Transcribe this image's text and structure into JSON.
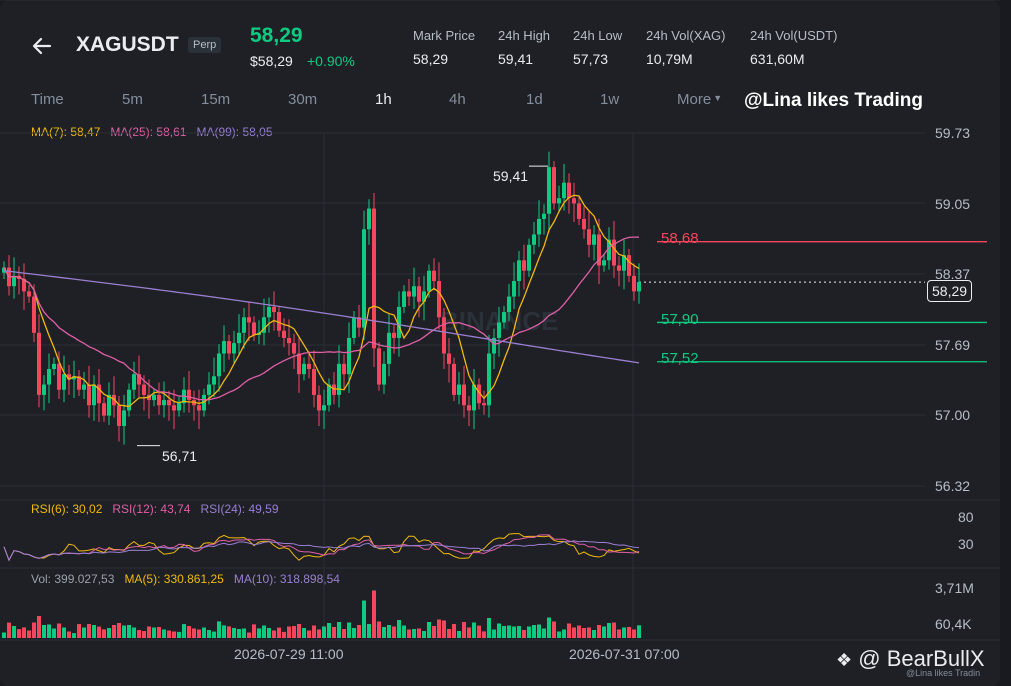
{
  "header": {
    "symbol": "XAGUSDT",
    "badge": "Perp",
    "last_price": "58,29",
    "last_price_usd": "$58,29",
    "change": "+0.90%",
    "stats": [
      {
        "label": "Mark Price",
        "value": "58,29"
      },
      {
        "label": "24h High",
        "value": "59,41"
      },
      {
        "label": "24h Low",
        "value": "57,73"
      },
      {
        "label": "24h Vol(XAG)",
        "value": "10,79M"
      },
      {
        "label": "24h Vol(USDT)",
        "value": "631,60M"
      }
    ]
  },
  "timeframes": [
    "Time",
    "5m",
    "15m",
    "30m",
    "1h",
    "4h",
    "1d",
    "1w",
    "More"
  ],
  "active_timeframe": "1h",
  "watermark_text": "@Lina likes Trading",
  "ma_legend": {
    "ma7": "MA(7): 58,47",
    "ma25": "MA(25): 58,61",
    "ma99": "MA(99): 58,05"
  },
  "rsi_legend": {
    "rsi6": "RSI(6): 30,02",
    "rsi12": "RSI(12): 43,74",
    "rsi24": "RSI(24): 49,59"
  },
  "vol_legend": {
    "vol": "Vol: 399.027,53",
    "ma5": "MA(5): 330.861,25",
    "ma10": "MA(10): 318.898,54"
  },
  "price_axis": [
    "59.73",
    "59.05",
    "58.37",
    "57.69",
    "57.00",
    "56.32"
  ],
  "rsi_axis": [
    "80",
    "30"
  ],
  "vol_axis": [
    "3,71M",
    "60,4K"
  ],
  "time_axis": [
    "2026-07-29 11:00",
    "2026-07-31 07:00"
  ],
  "levels": [
    {
      "label": "58,68",
      "value": 58.68,
      "color": "#f6465d"
    },
    {
      "label": "57,90",
      "value": 57.9,
      "color": "#0ecb81"
    },
    {
      "label": "57,52",
      "value": 57.52,
      "color": "#0ecb81"
    }
  ],
  "current_price": {
    "label": "58,29",
    "value": 58.29
  },
  "high_marker": {
    "label": "59,41",
    "value": 59.41
  },
  "low_marker": {
    "label": "56,71",
    "value": 56.71
  },
  "footer_brand": "@ BearBullX",
  "footer_small": "@Lina likes Tradin",
  "colors": {
    "up": "#0ecb81",
    "down": "#f6465d",
    "ma7": "#f0b90b",
    "ma25": "#e05fa6",
    "ma99": "#9a7fd1"
  },
  "chart_data": {
    "type": "candlestick",
    "interval": "1h",
    "ylim": [
      56.32,
      59.73
    ],
    "candles_close": [
      58.43,
      58.25,
      58.35,
      58.32,
      58.2,
      58.15,
      57.8,
      57.2,
      57.3,
      57.45,
      57.5,
      57.25,
      57.4,
      57.35,
      57.38,
      57.25,
      57.3,
      57.1,
      57.3,
      57.12,
      57.0,
      57.2,
      57.1,
      56.9,
      57.05,
      57.25,
      57.4,
      57.3,
      57.2,
      57.15,
      57.2,
      57.1,
      57.15,
      57.1,
      57.05,
      57.12,
      57.25,
      57.15,
      57.1,
      57.05,
      57.2,
      57.3,
      57.38,
      57.6,
      57.72,
      57.6,
      57.7,
      57.8,
      57.95,
      57.9,
      57.78,
      57.8,
      57.95,
      58.05,
      58.0,
      57.82,
      57.75,
      57.7,
      57.6,
      57.4,
      57.5,
      57.45,
      57.2,
      57.05,
      57.1,
      57.3,
      57.2,
      57.5,
      57.4,
      57.75,
      57.95,
      57.85,
      58.8,
      59.0,
      57.65,
      57.3,
      57.5,
      57.8,
      57.75,
      58.05,
      58.2,
      58.15,
      58.25,
      58.1,
      58.2,
      58.4,
      58.3,
      57.95,
      57.6,
      57.5,
      57.2,
      57.3,
      57.1,
      57.05,
      57.3,
      57.12,
      57.1,
      57.6,
      57.75,
      57.9,
      58.0,
      58.15,
      58.3,
      58.5,
      58.4,
      58.65,
      58.75,
      58.9,
      58.95,
      59.4,
      59.05,
      59.1,
      59.25,
      59.1,
      59.05,
      58.9,
      58.8,
      58.65,
      58.75,
      58.45,
      58.5,
      58.7,
      58.45,
      58.4,
      58.55,
      58.35,
      58.2,
      58.29
    ],
    "rsi_ylim": [
      0,
      100
    ],
    "volume_unit": "USDT"
  }
}
